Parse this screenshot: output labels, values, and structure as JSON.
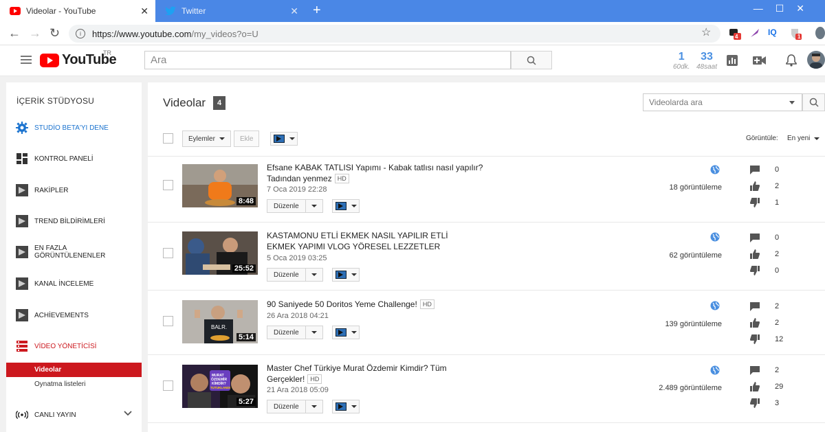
{
  "browser": {
    "tabs": [
      {
        "title": "Videolar - YouTube",
        "active": true
      },
      {
        "title": "Twitter",
        "active": false
      }
    ],
    "url_host": "https://www.youtube.com",
    "url_path": "/my_videos?o=U",
    "ext_badges": [
      "4",
      "1"
    ],
    "ext_iq": "IQ"
  },
  "header": {
    "logo_text": "YouTube",
    "logo_region": "TR",
    "search_placeholder": "Ara",
    "stat1": {
      "value": "1",
      "unit": "60dk."
    },
    "stat2": {
      "value": "33",
      "unit": "48saat"
    }
  },
  "sidebar": {
    "title": "İÇERİK STÜDYOSU",
    "items": [
      {
        "label": "STUDİO BETA'YI DENE"
      },
      {
        "label": "KONTROL PANELİ"
      },
      {
        "label": "RAKİPLER"
      },
      {
        "label": "TREND BİLDİRİMLERİ"
      },
      {
        "label": "EN FAZLA GÖRÜNTÜLENENLER"
      },
      {
        "label": "KANAL İNCELEME"
      },
      {
        "label": "ACHİEVEMENTS"
      },
      {
        "label": "VİDEO YÖNETİCİSİ"
      }
    ],
    "subitems": [
      {
        "label": "Videolar"
      },
      {
        "label": "Oynatma listeleri"
      }
    ],
    "live": "CANLI YAYIN"
  },
  "main": {
    "title": "Videolar",
    "count": "4",
    "search_placeholder": "Videolarda ara",
    "actions_label": "Eylemler",
    "add_label": "Ekle",
    "view_label": "Görüntüle:",
    "view_value": "En yeni",
    "edit_label": "Düzenle",
    "hd_label": "HD",
    "videos": [
      {
        "title": "Efsane KABAK TATLISI Yapımı - Kabak tatlısı nasıl yapılır? Tadından yenmez",
        "hd": true,
        "date": "7 Oca 2019 22:28",
        "duration": "8:48",
        "views": "18 görüntüleme",
        "comments": "0",
        "likes": "2",
        "dislikes": "1"
      },
      {
        "title": "KASTAMONU ETLİ EKMEK NASIL YAPILIR ETLİ EKMEK YAPIMI VLOG YÖRESEL LEZZETLER",
        "hd": false,
        "date": "5 Oca 2019 03:25",
        "duration": "25:52",
        "views": "62 görüntüleme",
        "comments": "0",
        "likes": "2",
        "dislikes": "0"
      },
      {
        "title": "90 Saniyede 50 Doritos Yeme Challenge!",
        "hd": true,
        "date": "26 Ara 2018 04:21",
        "duration": "5:14",
        "views": "139 görüntüleme",
        "comments": "2",
        "likes": "2",
        "dislikes": "12"
      },
      {
        "title": "Master Chef Türkiye Murat Özdemir Kimdir? Tüm Gerçekler!",
        "hd": true,
        "date": "21 Ara 2018 05:09",
        "duration": "5:27",
        "views": "2.489 görüntüleme",
        "comments": "2",
        "likes": "29",
        "dislikes": "3",
        "thumb_text": "MURAT ÖZDEMİR KİMDİR? TUTUKLANDI MI?"
      }
    ]
  }
}
